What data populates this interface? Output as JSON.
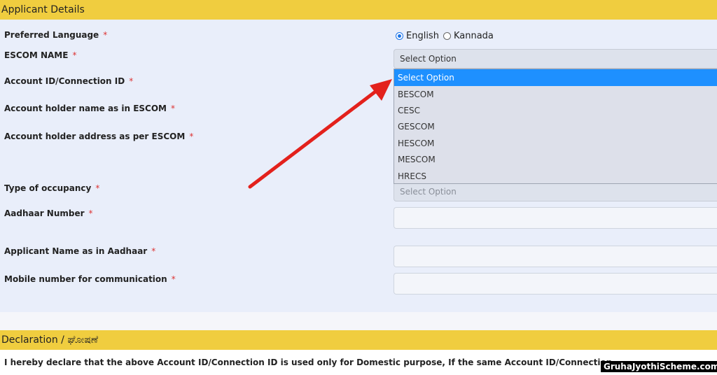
{
  "sections": {
    "applicant_title": "Applicant Details",
    "declaration_title": "Declaration / ಘೋಷಣೆ",
    "declaration_text": "I hereby declare that the above Account ID/Connection ID is used only for Domestic purpose, If the same Account ID/Connection"
  },
  "required_mark": "*",
  "labels": {
    "preferred_language": "Preferred Language",
    "escom_name": "ESCOM NAME",
    "account_id": "Account ID/Connection ID",
    "account_holder_name": "Account holder name as in ESCOM",
    "account_holder_address": "Account holder address as per ESCOM",
    "occupancy": "Type of occupancy",
    "aadhaar": "Aadhaar Number",
    "applicant_name": "Applicant Name as in Aadhaar",
    "mobile": "Mobile number for communication"
  },
  "language": {
    "options": [
      "English",
      "Kannada"
    ],
    "selected": "English"
  },
  "escom_select": {
    "value": "Select Option",
    "options": [
      "Select Option",
      "BESCOM",
      "CESC",
      "GESCOM",
      "HESCOM",
      "MESCOM",
      "HRECS"
    ],
    "highlighted": "Select Option"
  },
  "occupancy_select": {
    "value": "Select Option"
  },
  "watermark": "GruhaJyothiScheme.com",
  "colors": {
    "header": "#f0cd3f",
    "panel": "#e9eefa",
    "highlight": "#1e90ff",
    "arrow": "#e3211c"
  }
}
